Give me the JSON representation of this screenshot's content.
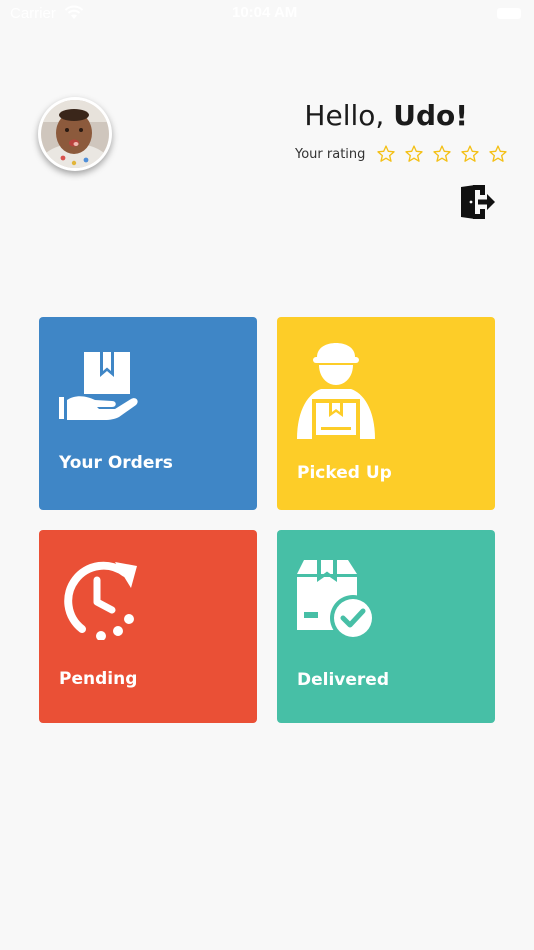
{
  "status_bar": {
    "carrier": "Carrier",
    "time": "10:04 AM"
  },
  "header": {
    "greeting": "Hello, ",
    "user_name": "Udo!",
    "rating_label": "Your rating",
    "rating_value": 0,
    "rating_max": 5
  },
  "tiles": [
    {
      "label": "Your Orders",
      "color": "#3f86c6",
      "icon": "package-hand-icon"
    },
    {
      "label": "Picked Up",
      "color": "#fdcd28",
      "icon": "delivery-man-icon"
    },
    {
      "label": "Pending",
      "color": "#ea5036",
      "icon": "clock-arrow-icon"
    },
    {
      "label": "Delivered",
      "color": "#47bfa6",
      "icon": "box-check-icon"
    }
  ],
  "colors": {
    "background": "#f8f8f8",
    "star": "#f4c016",
    "text": "#1b1b1b"
  }
}
